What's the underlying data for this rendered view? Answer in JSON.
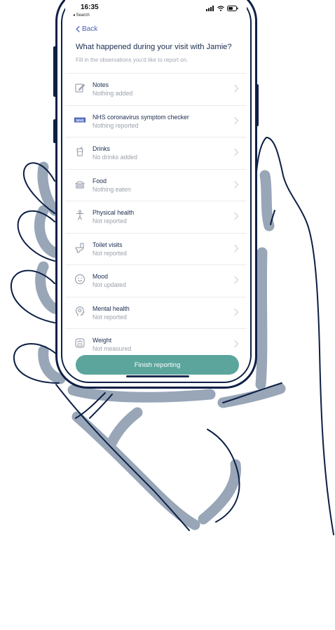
{
  "status_bar": {
    "time": "16:35",
    "back_app": "◂ Search"
  },
  "nav": {
    "back_label": "Back"
  },
  "header": {
    "title": "What happened during your visit with Jamie?",
    "subtitle": "Fill in the observations you'd like to report on."
  },
  "items": [
    {
      "icon": "notes-icon",
      "title": "Notes",
      "status": "Nothing added"
    },
    {
      "icon": "nhs-icon",
      "title": "NHS coronavirus symptom checker",
      "status": "Nothing reported"
    },
    {
      "icon": "drinks-icon",
      "title": "Drinks",
      "status": "No drinks added"
    },
    {
      "icon": "food-icon",
      "title": "Food",
      "status": "Nothing eaten"
    },
    {
      "icon": "physical-health-icon",
      "title": "Physical health",
      "status": "Not reported"
    },
    {
      "icon": "toilet-icon",
      "title": "Toilet visits",
      "status": "Not reported"
    },
    {
      "icon": "mood-icon",
      "title": "Mood",
      "status": "Not updated"
    },
    {
      "icon": "mental-health-icon",
      "title": "Mental health",
      "status": "Not reported"
    },
    {
      "icon": "weight-icon",
      "title": "Weight",
      "status": "Not measured"
    }
  ],
  "finish_label": "Finish reporting",
  "nhs_badge": "NHS",
  "colors": {
    "accent": "#5ba59d",
    "link": "#4a63b7",
    "ink": "#0d1f45",
    "shadow": "#98a6b8"
  }
}
